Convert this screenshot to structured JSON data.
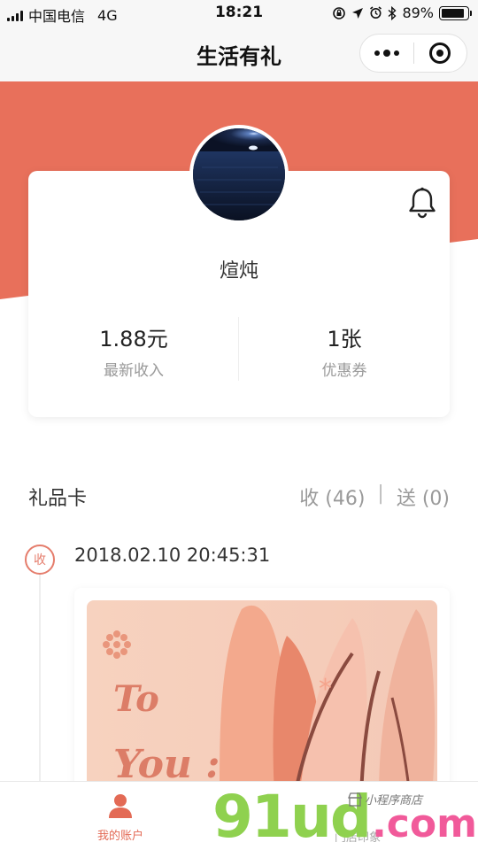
{
  "status_bar": {
    "carrier": "中国电信",
    "network": "4G",
    "time": "18:21",
    "battery": "89%",
    "battery_level": 0.89
  },
  "nav": {
    "title": "生活有礼",
    "more_icon": "more-dots-icon",
    "close_icon": "target-close-icon"
  },
  "colors": {
    "accent": "#e8705b",
    "accent_text": "#e36a55",
    "watermark_green": "#8fd14f",
    "watermark_pink": "#f15a9a"
  },
  "profile": {
    "username": "煊炖",
    "stats": [
      {
        "value": "1.88元",
        "label": "最新收入"
      },
      {
        "value": "1张",
        "label": "优惠券"
      }
    ],
    "bell_icon": "bell-icon"
  },
  "gift_section": {
    "title": "礼品卡",
    "received": "收 (46)",
    "separator": "|",
    "sent": "送 (0)"
  },
  "timeline": [
    {
      "badge": "收",
      "time": "2018.02.10 20:45:31",
      "card_line1": "To",
      "card_line2": "You :"
    }
  ],
  "tab_bar": {
    "account_label": "我的账户",
    "store_label": "门店印象"
  },
  "watermark": {
    "main": "91ud",
    "suffix": ".com",
    "store_text": "小程序商店"
  }
}
